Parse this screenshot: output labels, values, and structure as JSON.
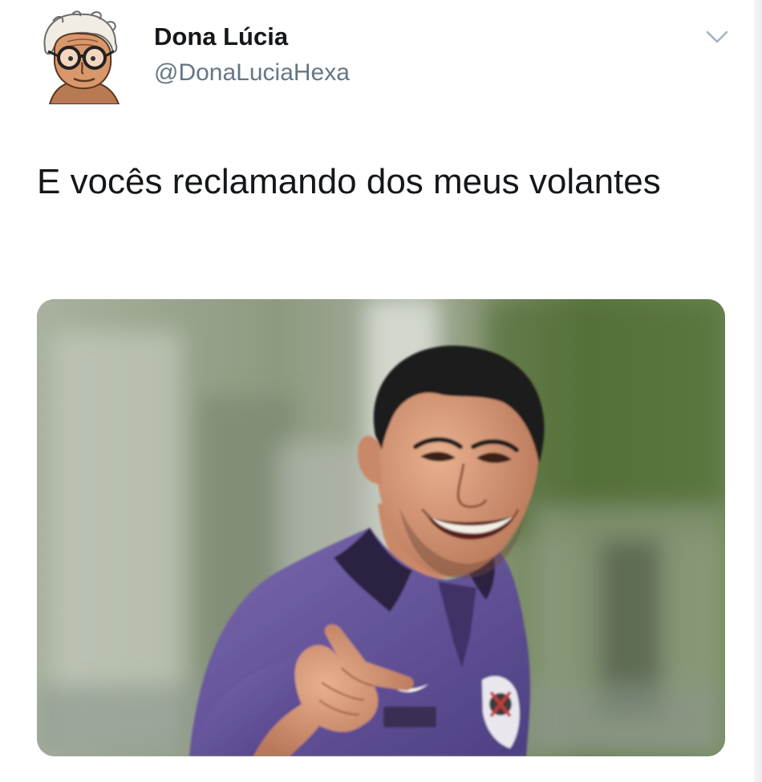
{
  "tweet": {
    "author": {
      "display_name": "Dona Lúcia",
      "handle": "@DonaLuciaHexa",
      "avatar_icon": "cartoon-elderly-woman-avatar"
    },
    "menu_icon": "chevron-down-icon",
    "text": "E vocês reclamando dos meus volantes",
    "media": {
      "subject": "smiling man in purple polo shirt pointing at camera"
    }
  },
  "colors": {
    "name_text": "#14171a",
    "handle_text": "#657786",
    "chevron": "#a7b4bf",
    "shirt": "#6a59a0"
  }
}
